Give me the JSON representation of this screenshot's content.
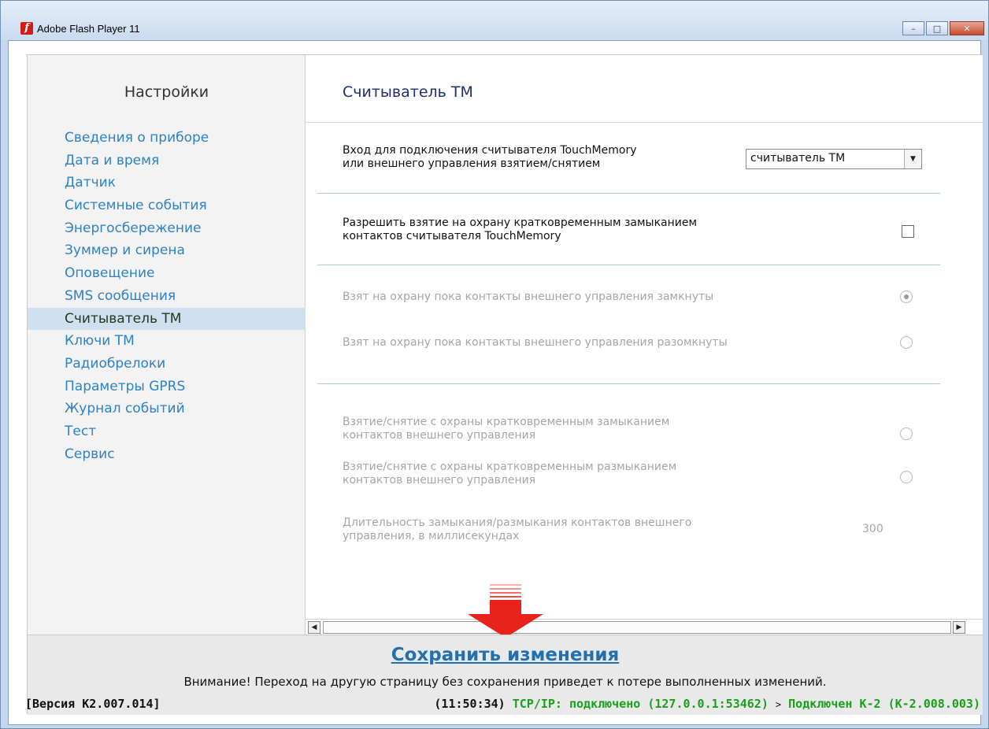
{
  "window": {
    "title": "Adobe Flash Player 11",
    "icon": "flash-player-icon",
    "buttons": {
      "minimize": "–",
      "maximize": "□",
      "close": "✕"
    }
  },
  "sidebar": {
    "title": "Настройки",
    "items": [
      {
        "label": "Сведения о приборе",
        "active": false
      },
      {
        "label": "Дата и время",
        "active": false
      },
      {
        "label": "Датчик",
        "active": false
      },
      {
        "label": "Системные события",
        "active": false
      },
      {
        "label": "Энергосбережение",
        "active": false
      },
      {
        "label": "Зуммер и сирена",
        "active": false
      },
      {
        "label": "Оповещение",
        "active": false
      },
      {
        "label": "SMS сообщения",
        "active": false
      },
      {
        "label": "Считыватель ТМ",
        "active": true
      },
      {
        "label": "Ключи ТМ",
        "active": false
      },
      {
        "label": "Радиобрелоки",
        "active": false
      },
      {
        "label": "Параметры GPRS",
        "active": false
      },
      {
        "label": "Журнал событий",
        "active": false
      },
      {
        "label": "Тест",
        "active": false
      },
      {
        "label": "Сервис",
        "active": false
      }
    ]
  },
  "main": {
    "title": "Считыватель ТМ",
    "input_label_1": "Вход для подключения считывателя TouchMemory",
    "input_label_2": "или внешнего управления взятием/снятием",
    "input_select": {
      "value": "считыватель ТМ",
      "arrow": "▼"
    },
    "allow_label_1": "Разрешить взятие на охрану кратковременным замыканием",
    "allow_label_2": "контактов считывателя TouchMemory",
    "allow_checked": false,
    "radio_closed_label": "Взят на охрану пока контакты внешнего управления замкнуты",
    "radio_closed_selected": true,
    "radio_open_label": "Взят на охрану пока контакты внешнего управления разомкнуты",
    "radio_open_selected": false,
    "short_close_label_1": "Взятие/снятие с охраны кратковременным замыканием",
    "short_close_label_2": "контактов внешнего управления",
    "short_open_label_1": "Взятие/снятие с охраны кратковременным размыканием",
    "short_open_label_2": "контактов внешнего управления",
    "duration_label_1": "Длительность замыкания/размыкания контактов внешнего",
    "duration_label_2": "управления, в миллисекундах",
    "duration_value": "300",
    "scroll_left": "◀",
    "scroll_right": "▶"
  },
  "footer": {
    "save_label": "Сохранить изменения",
    "warning": "Внимание! Переход на другую страницу без сохранения приведет к потере выполненных изменений.",
    "version": "[Версия К2.007.014]",
    "time": "(11:50:34)",
    "tcp": "TCP/IP: подключено (127.0.0.1:53462)",
    "sep": ">",
    "device": "Подключен К-2 (К-2.008.003)"
  },
  "colors": {
    "link": "#2e82c5",
    "save": "#2270b0",
    "status_green": "#1aa01a",
    "arrow_red": "#e8231c"
  }
}
